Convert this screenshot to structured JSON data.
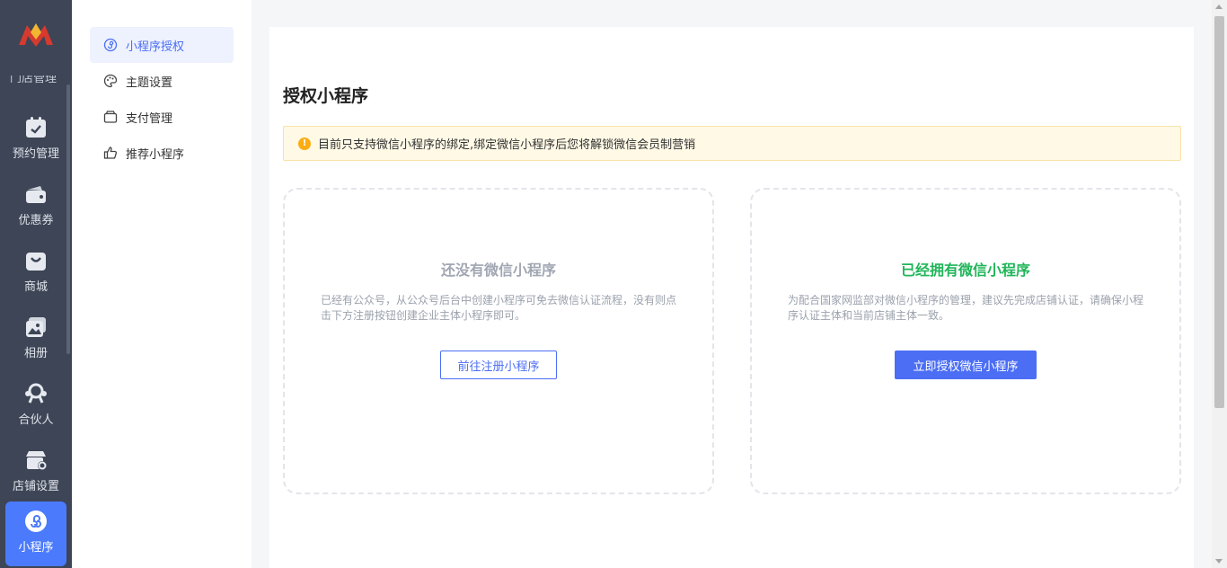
{
  "rail": {
    "partial_label": "门店管理",
    "items": [
      {
        "label": "预约管理",
        "icon": "calendar-icon"
      },
      {
        "label": "优惠券",
        "icon": "coupon-wallet-icon"
      },
      {
        "label": "商城",
        "icon": "shopping-bag-icon"
      },
      {
        "label": "相册",
        "icon": "album-icon"
      },
      {
        "label": "合伙人",
        "icon": "partner-icon"
      },
      {
        "label": "店铺设置",
        "icon": "store-settings-icon"
      },
      {
        "label": "小程序",
        "icon": "mini-program-icon",
        "active": true
      }
    ]
  },
  "subnav": {
    "items": [
      {
        "label": "小程序授权",
        "icon": "authorize-icon",
        "active": true
      },
      {
        "label": "主题设置",
        "icon": "palette-icon"
      },
      {
        "label": "支付管理",
        "icon": "wallet-icon"
      },
      {
        "label": "推荐小程序",
        "icon": "thumbs-up-icon"
      }
    ]
  },
  "main": {
    "title": "授权小程序",
    "notice": "目前只支持微信小程序的绑定,绑定微信小程序后您将解锁微信会员制营销",
    "left_panel": {
      "title": "还没有微信小程序",
      "desc": "已经有公众号，从公众号后台中创建小程序可免去微信认证流程，没有则点击下方注册按钮创建企业主体小程序即可。",
      "button": "前往注册小程序"
    },
    "right_panel": {
      "title": "已经拥有微信小程序",
      "desc": "为配合国家网监部对微信小程序的管理，建议先完成店铺认证，请确保小程序认证主体和当前店铺主体一致。",
      "button": "立即授权微信小程序"
    }
  },
  "colors": {
    "rail_bg": "#3d4556",
    "accent": "#4b6ef5",
    "success_title": "#20b559",
    "notice_bg": "#fff9e6"
  }
}
